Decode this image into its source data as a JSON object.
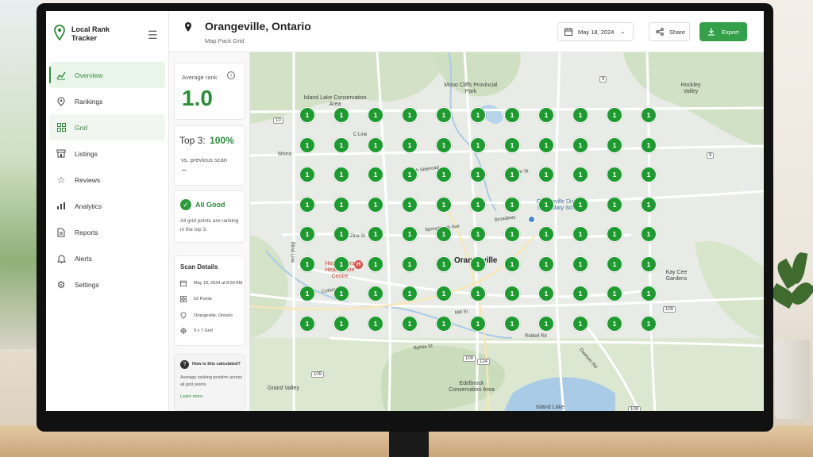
{
  "app": {
    "name": "Local Rank Tracker",
    "accent_color": "#2e8b3a",
    "button_color": "#34a04a",
    "marker_color": "#1e9a31"
  },
  "sidebar": {
    "items": [
      {
        "label": "Overview",
        "icon": "trend-chart-icon",
        "state": "active"
      },
      {
        "label": "Rankings",
        "icon": "map-pin-icon",
        "state": "normal"
      },
      {
        "label": "Grid",
        "icon": "grid-icon",
        "state": "selected"
      },
      {
        "label": "Listings",
        "icon": "store-icon",
        "state": "normal"
      },
      {
        "label": "Reviews",
        "icon": "star-icon",
        "state": "normal"
      },
      {
        "label": "Analytics",
        "icon": "bar-chart-icon",
        "state": "normal"
      },
      {
        "label": "Reports",
        "icon": "document-icon",
        "state": "normal"
      },
      {
        "label": "Alerts",
        "icon": "bell-icon",
        "state": "normal"
      },
      {
        "label": "Settings",
        "icon": "gear-icon",
        "state": "normal"
      }
    ]
  },
  "header": {
    "title": "Orangeville, Ontario",
    "subtitle": "Map Pack Grid",
    "date": "May 18, 2024",
    "share_label": "Share",
    "export_label": "Export"
  },
  "stats": {
    "average_rank_label": "Average rank",
    "average_rank_value": "1.0",
    "top3_label": "Top 3:",
    "top3_value": "100%",
    "vs_previous_label": "vs. previous scan",
    "vs_previous_value": "–",
    "status_title": "All Good",
    "status_text": "All grid points are ranking in the top 3.",
    "scan_details_title": "Scan Details",
    "scan_details": [
      {
        "icon": "calendar-icon",
        "text": "May 18, 2024 at 8:00 AM"
      },
      {
        "icon": "grid-icon",
        "text": "63 Points"
      },
      {
        "icon": "map-pin-icon",
        "text": "Orangeville, Ontario"
      },
      {
        "icon": "crosshair-icon",
        "text": "9 x 7 Grid"
      }
    ],
    "help_title": "How is this calculated?",
    "help_text": "Average ranking position across all grid points.",
    "learn_more": "Learn more"
  },
  "grid": {
    "rows": 8,
    "cols": 11,
    "rank_value": "1"
  },
  "map": {
    "labels": [
      {
        "text": "Mono Cliffs Provincial Park"
      },
      {
        "text": "Island Lake Conservation Area"
      },
      {
        "text": "Hockley Valley"
      },
      {
        "text": "Mono"
      },
      {
        "text": "C Line"
      },
      {
        "text": "5th Sideroad"
      },
      {
        "text": "Orangeville District Secondary School"
      },
      {
        "text": "Zina St"
      },
      {
        "text": "Springbrook Ave"
      },
      {
        "text": "Broadway"
      },
      {
        "text": "Orangeville"
      },
      {
        "text": "Headwaters Health Care Centre"
      },
      {
        "text": "Kay Cee Gardens"
      },
      {
        "text": "Mill St"
      },
      {
        "text": "Bythia St"
      },
      {
        "text": "Grand Valley"
      },
      {
        "text": "Edelbrock Conservation Area"
      },
      {
        "text": "Island Lake"
      },
      {
        "text": "Dawson Rd"
      },
      {
        "text": "Riddell Rd"
      },
      {
        "text": "Cotton Rd"
      },
      {
        "text": "Elgin St"
      },
      {
        "text": "Blind Line"
      }
    ],
    "route_shields": [
      "9",
      "10",
      "9",
      "109",
      "109",
      "124",
      "109",
      "109"
    ]
  }
}
